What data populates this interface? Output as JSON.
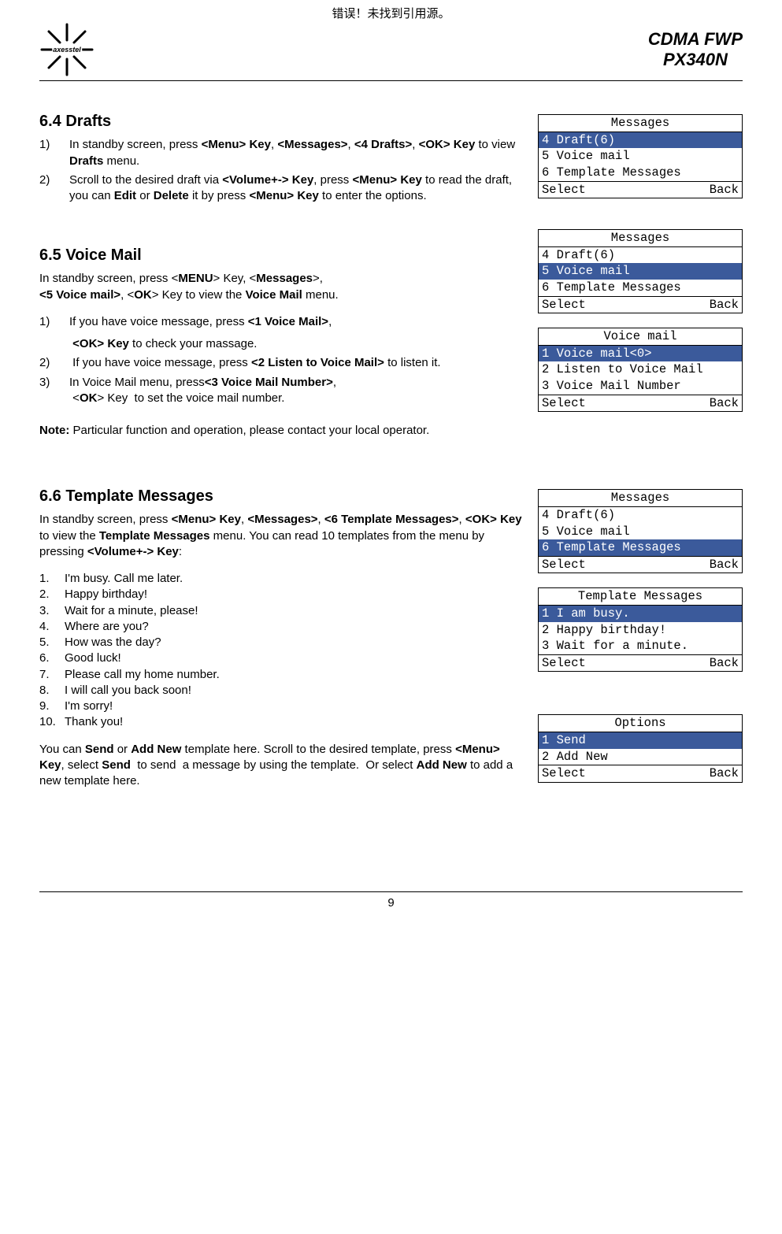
{
  "top_error": "错误！未找到引用源。",
  "header": {
    "logo_text": "axesstel",
    "title_line1": "CDMA FWP",
    "title_line2": "PX340N"
  },
  "sections": {
    "s64": {
      "heading": "6.4    Drafts",
      "p1_idx": "1)",
      "p1": "In standby screen, press <Menu> Key, <Messages>, <4 Drafts>, <OK> Key to view Drafts menu.",
      "p2_idx": "2)",
      "p2": "Scroll to the desired draft via <Volume+-> Key, press <Menu> Key to read the draft, you can Edit or Delete it by press <Menu> Key to enter the options."
    },
    "s65": {
      "heading": "6.5    Voice Mail",
      "intro1": "In standby screen, press <MENU> Key, <Messages>,",
      "intro2": "<5 Voice mail>, <OK> Key to view the Voice Mail menu.",
      "p1_idx": "1)",
      "p1a": "If you have voice message, press <1 Voice Mail>,",
      "p1b": " <OK> Key to check your massage.",
      "p2_idx": "2)",
      "p2": " If you have voice message, press <2 Listen to Voice Mail> to listen it.",
      "p3_idx": "3)",
      "p3a": "In Voice Mail menu, press<3 Voice Mail Number>,",
      "p3b": " <OK> Key  to set the voice mail number.",
      "note": "Note: Particular function and operation, please contact your local operator."
    },
    "s66": {
      "heading": "6.6    Template Messages",
      "intro": "In standby screen, press <Menu> Key, <Messages>, <6 Template Messages>, <OK> Key to view the Template Messages menu. You can read 10 templates from the menu by pressing <Volume+-> Key:",
      "templates": [
        "I'm busy. Call me later.",
        "Happy birthday!",
        "Wait for a minute, please!",
        "Where are you?",
        "How was the day?",
        "Good luck!",
        "Please call my home number.",
        "I will call you back soon!",
        "I'm sorry!",
        "Thank you!"
      ],
      "outro": "You can Send or Add New template here. Scroll to the desired template, press <Menu> Key, select Send  to send  a message by using the template.  Or select Add New to add a new template here."
    }
  },
  "ui": {
    "box1": {
      "title": "Messages",
      "items": [
        "4 Draft(6)",
        "5 Voice mail",
        "6 Template Messages"
      ],
      "hl": 0,
      "left": "Select",
      "right": "Back"
    },
    "box2": {
      "title": "Messages",
      "items": [
        "4 Draft(6)",
        "5 Voice mail",
        "6 Template Messages"
      ],
      "hl": 1,
      "left": "Select",
      "right": "Back"
    },
    "box3": {
      "title": "Voice mail",
      "items": [
        "1 Voice mail<0>",
        "2 Listen to Voice Mail",
        "3 Voice Mail Number"
      ],
      "hl": 0,
      "left": "Select",
      "right": "Back"
    },
    "box4": {
      "title": "Messages",
      "items": [
        "4 Draft(6)",
        "5 Voice mail",
        "6 Template Messages"
      ],
      "hl": 2,
      "left": "Select",
      "right": "Back"
    },
    "box5": {
      "title": "Template Messages",
      "items": [
        "1 I am busy.",
        "2 Happy birthday!",
        "3 Wait for a minute."
      ],
      "hl": 0,
      "left": "Select",
      "right": "Back"
    },
    "box6": {
      "title": "Options",
      "items": [
        "1 Send",
        "2 Add New"
      ],
      "hl": 0,
      "left": "Select",
      "right": "Back"
    }
  },
  "page_number": "9"
}
